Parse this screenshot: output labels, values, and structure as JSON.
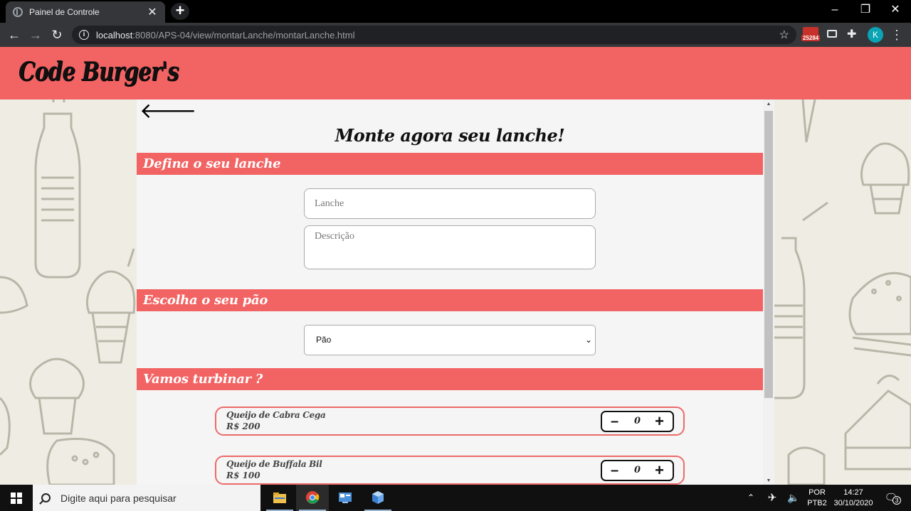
{
  "browser": {
    "tab_title": "Painel de Controle",
    "tab_close": "✕",
    "new_tab": "+",
    "url_host": "localhost",
    "url_rest": ":8080/APS-04/view/montarLanche/montarLanche.html",
    "mail_badge": "25284",
    "profile_initial": "K"
  },
  "site": {
    "logo": "Code Burger's",
    "page_title": "Monte agora seu lanche!",
    "sections": {
      "define": "Defina o seu lanche",
      "bread": "Escolha o seu pão",
      "extras": "Vamos turbinar ?"
    },
    "form": {
      "lanche_placeholder": "Lanche",
      "descricao_placeholder": "Descrição",
      "bread_select_value": "Pão"
    },
    "extras": [
      {
        "name": "Queijo de Cabra Cega",
        "price": "R$ 200",
        "qty": "0"
      },
      {
        "name": "Queijo de Buffala Bil",
        "price": "R$ 100",
        "qty": "0"
      }
    ]
  },
  "taskbar": {
    "search_placeholder": "Digite aqui para pesquisar",
    "lang_top": "POR",
    "lang_bottom": "PTB2",
    "time": "14:27",
    "date": "30/10/2020",
    "notifications": "3"
  },
  "colors": {
    "brand_red": "#f26363",
    "chrome_dark": "#35363a"
  }
}
